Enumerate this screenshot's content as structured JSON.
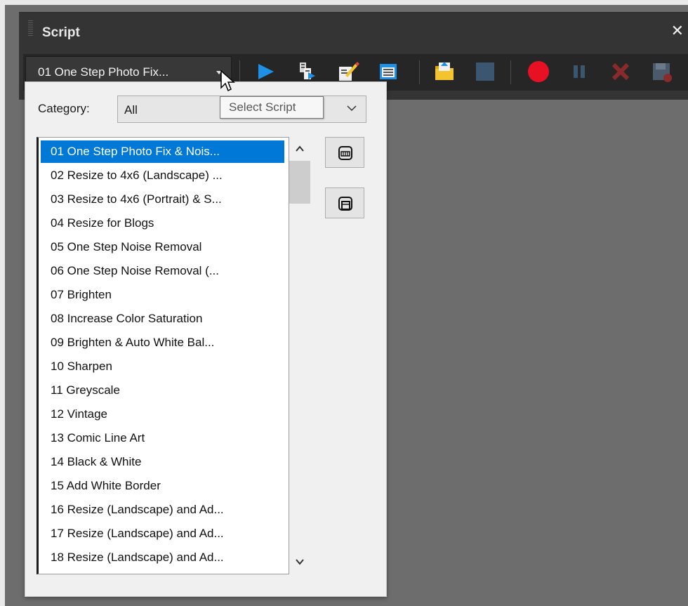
{
  "palette": {
    "title": "Script",
    "close_glyph": "✕",
    "script_combo_value": "01 One Step Photo Fix...",
    "toolbar_buttons": [
      "run-icon",
      "run-editor-icon",
      "edit-script-icon",
      "text-editor-icon",
      "open-folder-icon",
      "stop-icon",
      "record-icon",
      "pause-icon",
      "cancel-icon",
      "save-icon"
    ]
  },
  "dropdown": {
    "category_label": "Category:",
    "category_value": "All",
    "scripts": [
      "01 One Step Photo Fix & Nois...",
      "02 Resize to 4x6 (Landscape) ...",
      "03 Resize to 4x6 (Portrait) & S...",
      "04 Resize for Blogs",
      "05 One Step Noise Removal",
      "06 One Step Noise Removal (...",
      "07 Brighten",
      "08 Increase Color Saturation",
      "09 Brighten & Auto White Bal...",
      "10 Sharpen",
      "11 Greyscale",
      "12 Vintage",
      "13 Comic Line Art",
      "14 Black & White",
      "15 Add White Border",
      "16 Resize (Landscape) and Ad...",
      "17 Resize (Landscape) and Ad...",
      "18 Resize (Landscape) and Ad..."
    ],
    "selected_index": 0
  },
  "tooltip": {
    "text": "Select Script"
  },
  "colors": {
    "selection": "#0078d7",
    "palette_bg": "#343434",
    "workspace_bg": "#6d6d6d",
    "run_blue": "#1e90e8",
    "record_red": "#e81123"
  }
}
